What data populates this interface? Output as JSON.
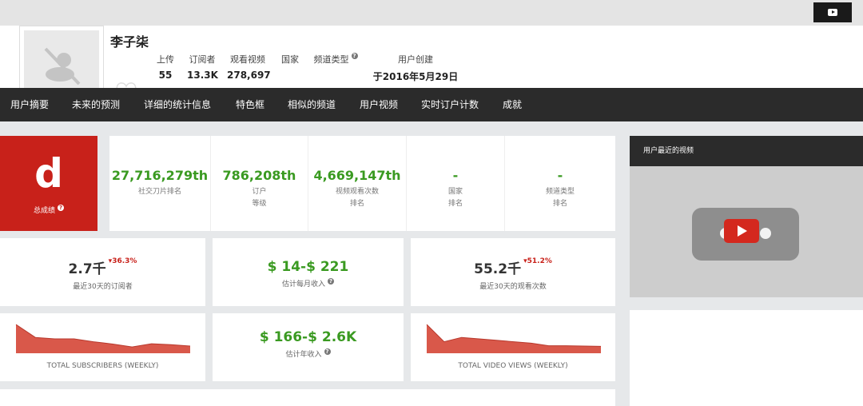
{
  "channel": {
    "name": "李子柒",
    "stats": [
      {
        "label": "上传",
        "value": "55"
      },
      {
        "label": "订阅者",
        "value": "13.3K"
      },
      {
        "label": "观看视频",
        "value": "278,697"
      },
      {
        "label": "国家",
        "value": ""
      },
      {
        "label": "频道类型",
        "value": ""
      },
      {
        "label": "用户创建",
        "value": "于2016年5月29日"
      }
    ]
  },
  "nav": [
    "用户摘要",
    "未来的预测",
    "详细的统计信息",
    "特色框",
    "相似的频道",
    "用户视频",
    "实时订户计数",
    "成就"
  ],
  "grade": {
    "letter": "d",
    "label": "总成绩"
  },
  "ranks": [
    {
      "value": "27,716,279th",
      "line1": "社交刀片排名",
      "line2": ""
    },
    {
      "value": "786,208th",
      "line1": "订户",
      "line2": "等级"
    },
    {
      "value": "4,669,147th",
      "line1": "视频观看次数",
      "line2": "排名"
    },
    {
      "value": "-",
      "line1": "国家",
      "line2": "排名"
    },
    {
      "value": "-",
      "line1": "频道类型",
      "line2": "排名"
    }
  ],
  "metrics": {
    "subs30": {
      "value": "2.7千",
      "change": "36.3%",
      "label": "最近30天的订阅者"
    },
    "monthly": {
      "value": "$ 14-$ 221",
      "label": "估计每月收入"
    },
    "views30": {
      "value": "55.2千",
      "change": "51.2%",
      "label": "最近30天的观看次数"
    },
    "yearly": {
      "value": "$ 166-$ 2.6K",
      "label": "估计年收入"
    }
  },
  "charts": {
    "subscribers_label": "TOTAL SUBSCRIBERS (WEEKLY)",
    "views_label": "TOTAL VIDEO VIEWS (WEEKLY)"
  },
  "chart_data": [
    {
      "type": "area",
      "title": "TOTAL SUBSCRIBERS (WEEKLY)",
      "values": [
        10,
        5.5,
        5,
        5,
        4,
        3.2,
        2.2,
        3.3,
        3,
        2.5
      ],
      "color": "#d9584a"
    },
    {
      "type": "area",
      "title": "TOTAL VIDEO VIEWS (WEEKLY)",
      "values": [
        10,
        4,
        5.5,
        5,
        4.5,
        4,
        3.5,
        2.6,
        2.6,
        2.5,
        2.4
      ],
      "color": "#d9584a"
    }
  ],
  "sidebar": {
    "title": "用户最近的视频"
  },
  "colors": {
    "accent_red": "#c8211a",
    "green": "#3a9a21",
    "nav": "#2b2b2b"
  }
}
